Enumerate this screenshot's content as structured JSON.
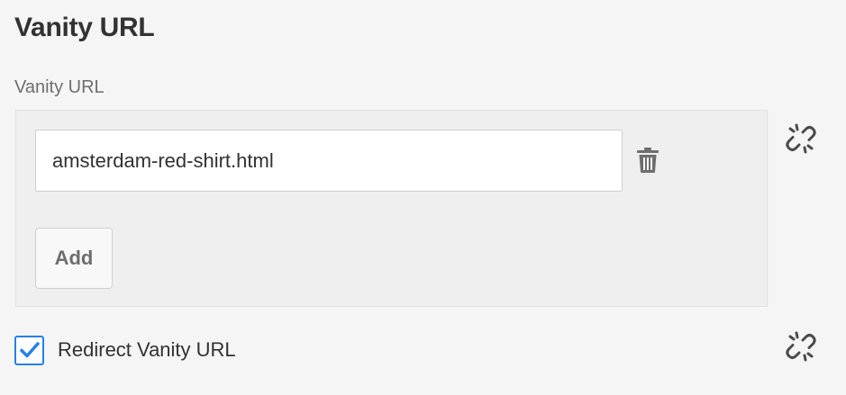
{
  "section": {
    "title": "Vanity URL"
  },
  "vanity_url_field": {
    "label": "Vanity URL",
    "items": [
      {
        "value": "amsterdam-red-shirt.html",
        "delete_icon": "trash-icon"
      }
    ],
    "add_label": "Add",
    "inherit_icon": "broken-link-icon"
  },
  "redirect": {
    "label": "Redirect Vanity URL",
    "checked": true,
    "inherit_icon": "broken-link-icon"
  },
  "colors": {
    "accent": "#2680eb",
    "background": "#f5f5f5",
    "panel": "#efefef",
    "text": "#323232",
    "muted_text": "#6e6e6e"
  }
}
